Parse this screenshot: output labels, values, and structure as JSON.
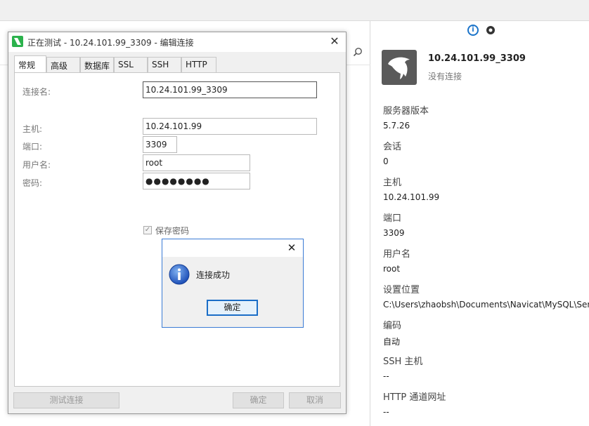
{
  "edit_window": {
    "title": "正在测试 - 10.24.101.99_3309 - 编辑连接",
    "tabs": [
      {
        "label": "常规",
        "active": true
      },
      {
        "label": "高级"
      },
      {
        "label": "数据库"
      },
      {
        "label": "SSL"
      },
      {
        "label": "SSH"
      },
      {
        "label": "HTTP"
      }
    ],
    "fields": {
      "connection_name": {
        "label": "连接名:",
        "value": "10.24.101.99_3309"
      },
      "host": {
        "label": "主机:",
        "value": "10.24.101.99"
      },
      "port": {
        "label": "端口:",
        "value": "3309"
      },
      "username": {
        "label": "用户名:",
        "value": "root"
      },
      "password": {
        "label": "密码:",
        "value": "●●●●●●●●"
      }
    },
    "save_password": {
      "label": "保存密码",
      "checked": true
    },
    "buttons": {
      "test": "测试连接",
      "ok": "确定",
      "cancel": "取消"
    }
  },
  "message_box": {
    "text": "连接成功",
    "ok": "确定",
    "icon": "info-icon"
  },
  "info_panel": {
    "connection_name": "10.24.101.99_3309",
    "status": "没有连接",
    "properties": [
      {
        "label": "服务器版本",
        "value": "5.7.26"
      },
      {
        "label": "会话",
        "value": "0"
      },
      {
        "label": "主机",
        "value": "10.24.101.99"
      },
      {
        "label": "端口",
        "value": "3309"
      },
      {
        "label": "用户名",
        "value": "root"
      },
      {
        "label": "设置位置",
        "value": "C:\\Users\\zhaobsh\\Documents\\Navicat\\MySQL\\Serv"
      },
      {
        "label": "编码",
        "value": "自动"
      },
      {
        "label": "SSH 主机",
        "value": "--"
      },
      {
        "label": "HTTP 通道网址",
        "value": "--"
      }
    ]
  },
  "colors": {
    "accent": "#1a73c9",
    "navicat_green": "#2bb24c",
    "logo_bg": "#5a5a5a"
  }
}
